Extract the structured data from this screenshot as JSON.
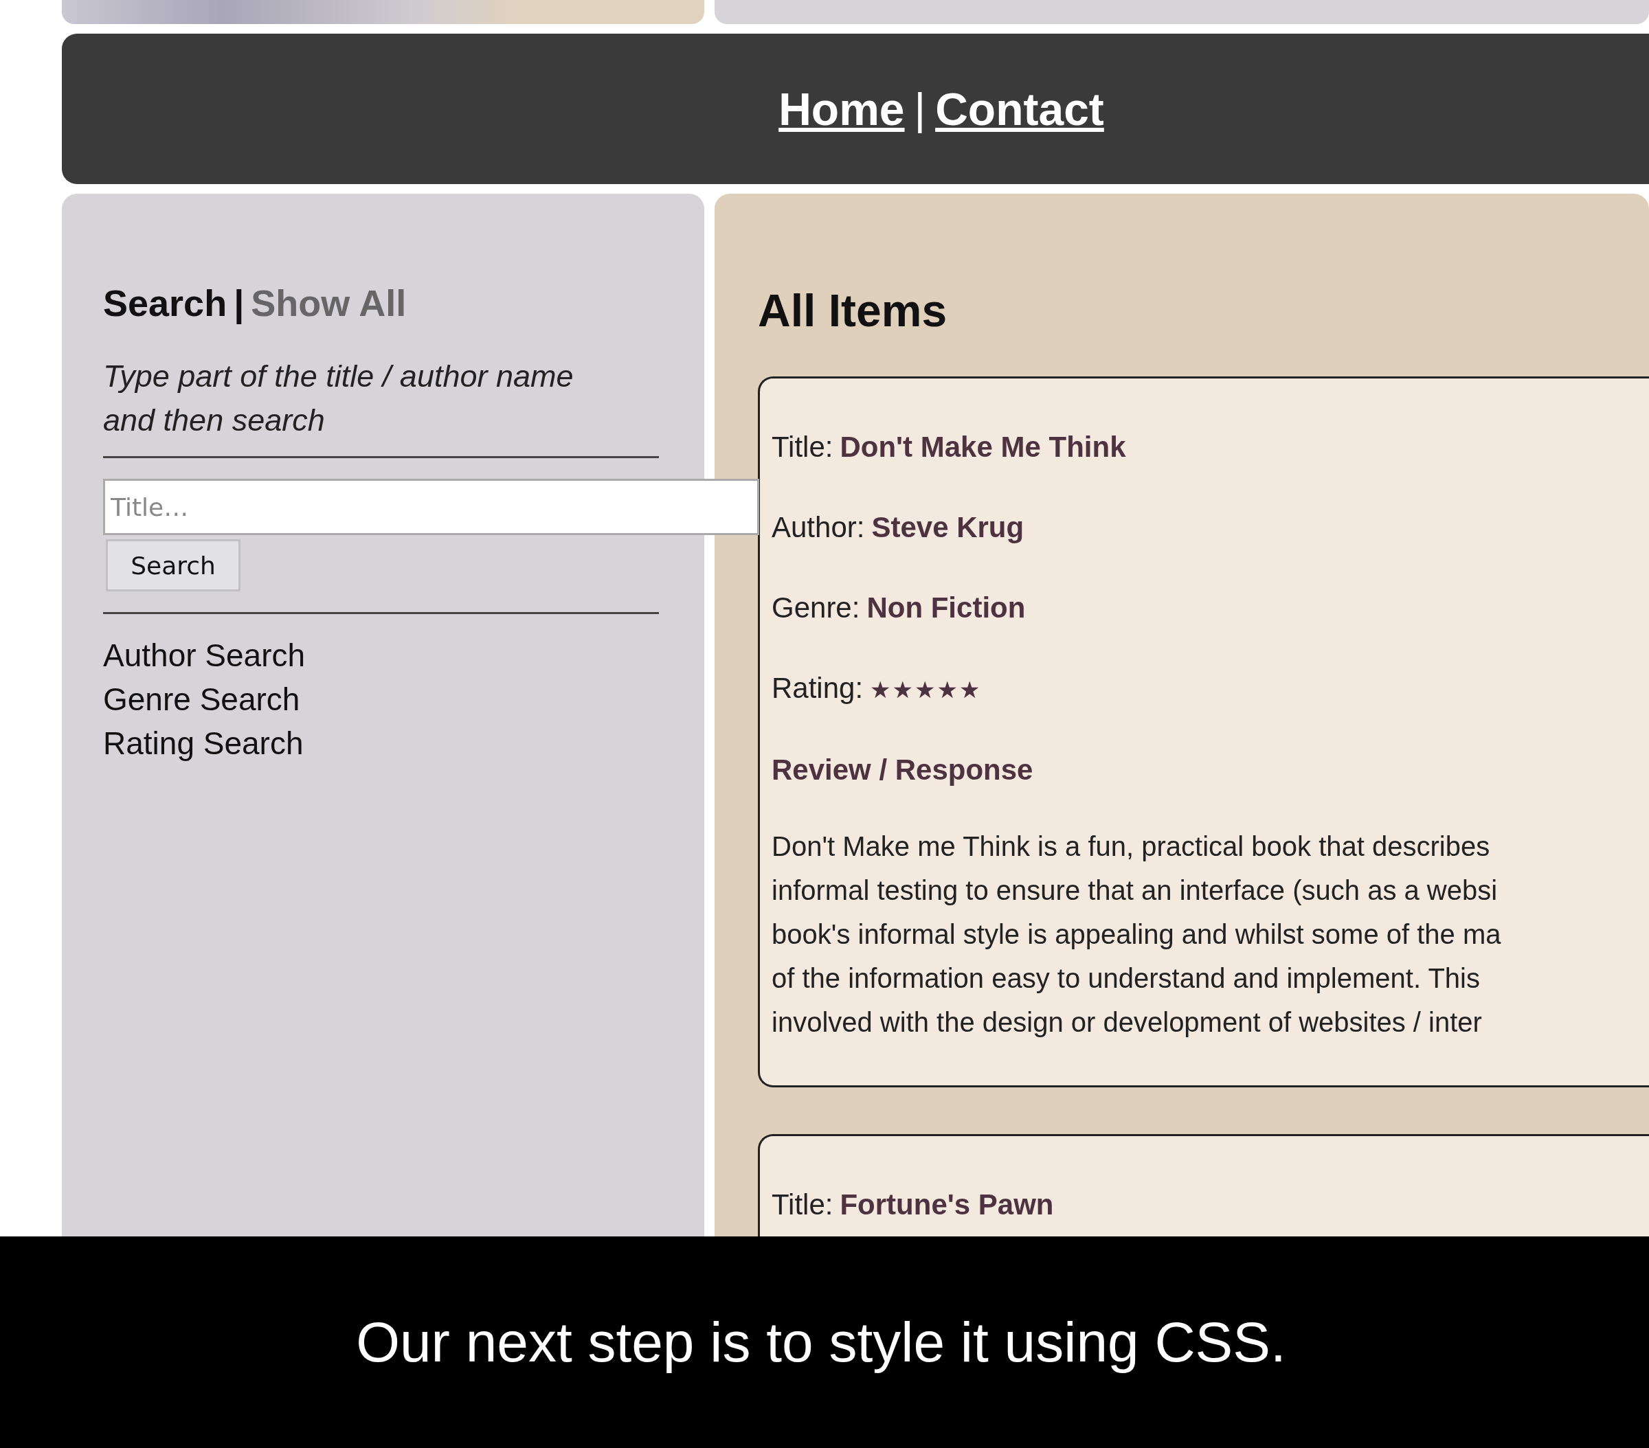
{
  "nav": {
    "links": [
      {
        "label": "Home"
      },
      {
        "label": "Contact"
      }
    ],
    "separator": "|"
  },
  "sidebar": {
    "heading": {
      "current": "Search",
      "separator": "|",
      "link": "Show All"
    },
    "hint": "Type part of the title / author name and then search",
    "search_field": {
      "placeholder": "Title…"
    },
    "search_button": "Search",
    "links": [
      "Author Search",
      "Genre Search",
      "Rating Search"
    ]
  },
  "main": {
    "heading": "All Items",
    "items": [
      {
        "fields": [
          {
            "label": "Title:",
            "value": "Don't Make Me Think"
          },
          {
            "label": "Author:",
            "value": "Steve Krug"
          },
          {
            "label": "Genre:",
            "value": "Non Fiction"
          }
        ],
        "rating_label": "Rating:",
        "stars": 5,
        "review_heading": "Review / Response",
        "review_lines": [
          "Don't Make me Think is a fun, practical book that describes",
          "informal testing to ensure that an interface (such as a websi",
          "book's informal style is appealing and whilst some of the ma",
          "of the information easy to understand and implement. This",
          "involved with the design or development of websites / inter"
        ]
      },
      {
        "fields": [
          {
            "label": "Title:",
            "value": "Fortune's Pawn"
          }
        ]
      }
    ]
  },
  "caption": "Our next step is to style it using CSS."
}
